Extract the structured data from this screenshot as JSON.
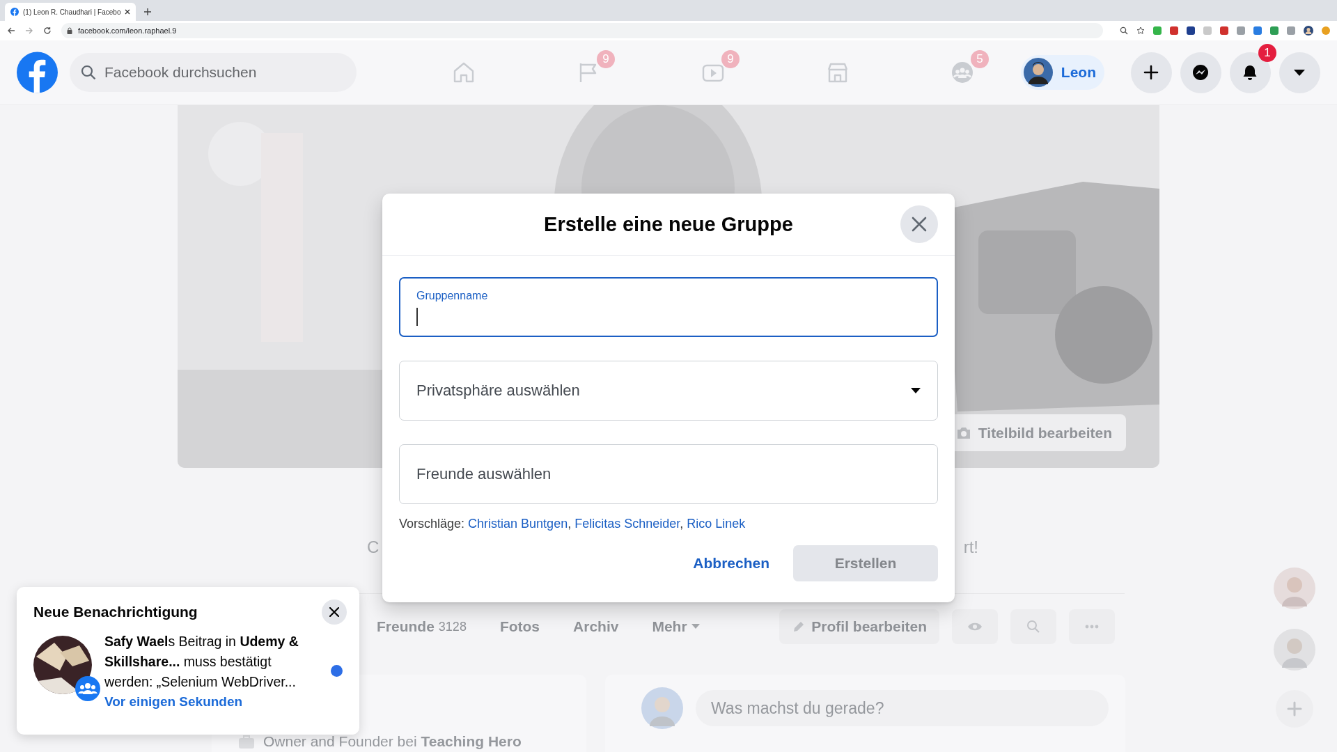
{
  "browser": {
    "tab_title": "(1) Leon R. Chaudhari | Facebo",
    "url": "facebook.com/leon.raphael.9"
  },
  "nav": {
    "search": {
      "placeholder": "Facebook durchsuchen"
    },
    "tabs": [
      {
        "kind": "home"
      },
      {
        "kind": "pages",
        "badge": "9"
      },
      {
        "kind": "watch",
        "badge": "9"
      },
      {
        "kind": "marketplace"
      },
      {
        "kind": "groups",
        "badge": "5"
      }
    ],
    "profile_chip": {
      "name": "Leon"
    },
    "actions": [
      {
        "kind": "create"
      },
      {
        "kind": "messenger"
      },
      {
        "kind": "notifications",
        "badge": "1"
      },
      {
        "kind": "menu"
      }
    ]
  },
  "cover": {
    "kind": "picture",
    "edit_button": "Titelbild bearbeiten"
  },
  "intro_fragments": {
    "left": "C",
    "right": "rt!"
  },
  "profile_tabs": [
    {
      "label": "Freunde",
      "count": "3128"
    },
    {
      "label": "Fotos"
    },
    {
      "label": "Archiv"
    },
    {
      "label": "Mehr",
      "dropdown": true
    }
  ],
  "profile_actions": {
    "edit": "Profil bearbeiten"
  },
  "intro": {
    "work": "Owner and Founder bei **Teaching Hero**"
  },
  "composer": {
    "placeholder": "Was machst du gerade?"
  },
  "dialog": {
    "title": "Erstelle eine neue Gruppe",
    "fields": [
      {
        "kind": "text",
        "label": "Gruppenname",
        "focused": true
      },
      {
        "kind": "select",
        "placeholder": "Privatsphäre auswählen",
        "focused": false
      },
      {
        "kind": "text",
        "placeholder": "Freunde auswählen",
        "focused": false
      }
    ],
    "suggestions": {
      "label": "Vorschläge:",
      "separator": ",",
      "names": [
        "Christian Buntgen",
        "Felicitas Schneider",
        "Rico Linek"
      ]
    },
    "buttons": [
      {
        "label": "Abbrechen",
        "kind": "link",
        "disabled": false
      },
      {
        "label": "Erstellen",
        "kind": "primary",
        "disabled": true
      }
    ]
  },
  "notification": {
    "title": "Neue Benachrichtigung",
    "text": "**Safy Wael**s Beitrag in **Udemy & Skillshare...** muss bestätigt werden: „Selenium WebDriver...",
    "time": "Vor einigen Sekunden",
    "unread": true
  }
}
